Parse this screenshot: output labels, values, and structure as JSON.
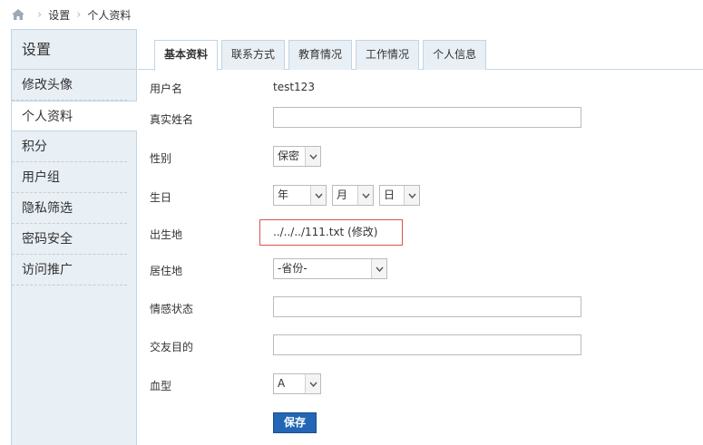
{
  "breadcrumb": {
    "items": [
      "设置",
      "个人资料"
    ]
  },
  "sidebar": {
    "title": "设置",
    "items": [
      {
        "label": "修改头像"
      },
      {
        "label": "个人资料"
      },
      {
        "label": "积分"
      },
      {
        "label": "用户组"
      },
      {
        "label": "隐私筛选"
      },
      {
        "label": "密码安全"
      },
      {
        "label": "访问推广"
      }
    ]
  },
  "tabs": [
    "基本资料",
    "联系方式",
    "教育情况",
    "工作情况",
    "个人信息"
  ],
  "form": {
    "username_label": "用户名",
    "username_value": "test123",
    "realname_label": "真实姓名",
    "gender_label": "性别",
    "gender_value": "保密",
    "birthday_label": "生日",
    "birthday_year": "年",
    "birthday_month": "月",
    "birthday_day": "日",
    "birthplace_label": "出生地",
    "birthplace_value": "../../../111.txt",
    "birthplace_edit": "(修改)",
    "residence_label": "居住地",
    "residence_value": "-省份-",
    "relationship_label": "情感状态",
    "purpose_label": "交友目的",
    "bloodtype_label": "血型",
    "bloodtype_value": "A",
    "save_label": "保存"
  }
}
